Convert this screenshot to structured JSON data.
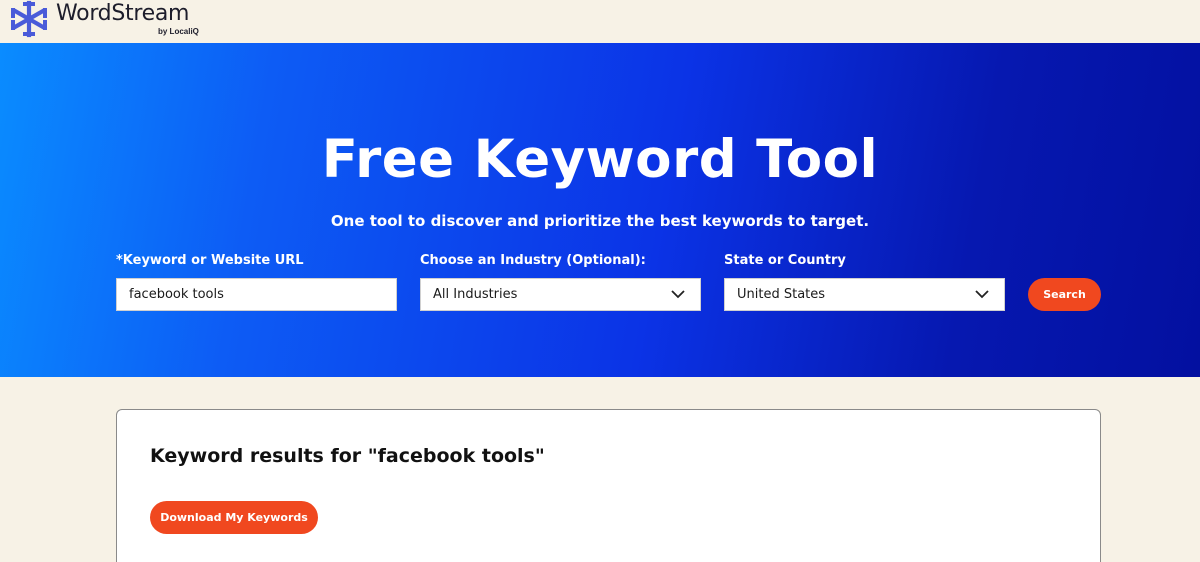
{
  "header": {
    "logo_name": "WordStream",
    "logo_sub": "by LocaliQ",
    "logo_icon": "wordstream-snowflake-icon",
    "logo_color": "#4a5bd9"
  },
  "hero": {
    "title": "Free Keyword Tool",
    "subtitle": "One tool to discover and prioritize the best keywords to target.",
    "keyword_field": {
      "label": "*Keyword or Website URL",
      "value": "facebook tools"
    },
    "industry_field": {
      "label": "Choose an Industry (Optional):",
      "value": "All Industries",
      "icon": "chevron-down-icon"
    },
    "location_field": {
      "label": "State or Country",
      "value": "United States",
      "icon": "chevron-down-icon"
    },
    "search_button": "Search"
  },
  "results": {
    "title": "Keyword results for \"facebook tools\"",
    "download_button": "Download My Keywords"
  },
  "colors": {
    "accent": "#f0481f",
    "background": "#f7f2e6",
    "hero_start": "#0a8cff",
    "hero_end": "#0310a0"
  }
}
